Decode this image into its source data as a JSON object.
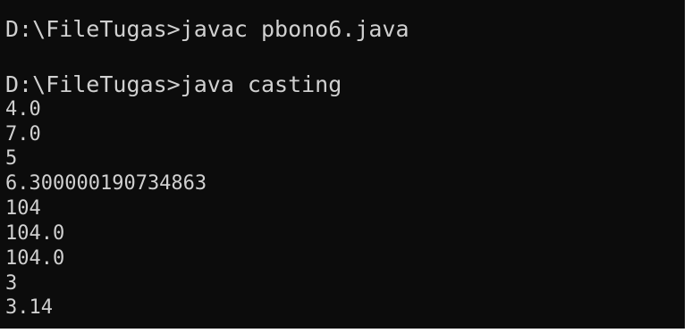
{
  "console": {
    "background": "#0c0c0c",
    "foreground": "#d0d0d0",
    "lines": [
      "D:\\FileTugas>javac pbono6.java",
      "",
      "D:\\FileTugas>java casting",
      "4.0",
      "7.0",
      "5",
      "6.300000190734863",
      "104",
      "104.0",
      "104.0",
      "3",
      "3.14"
    ]
  }
}
